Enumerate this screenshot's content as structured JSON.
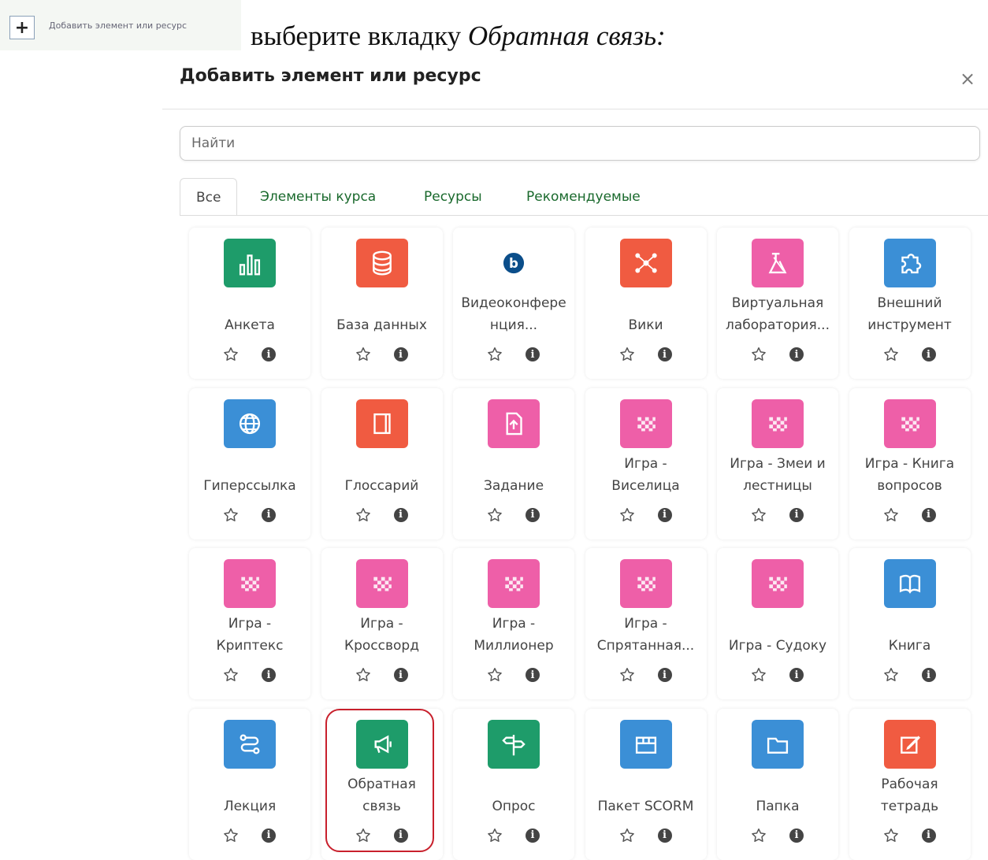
{
  "top": {
    "add_button_symbol": "+",
    "add_link_small": "Добавить элемент или ресурс",
    "instruction_prefix": "выберите вкладку ",
    "instruction_italic": "Обратная связь:"
  },
  "modal": {
    "title": "Добавить элемент или ресурс",
    "close": "×",
    "search_placeholder": "Найти",
    "tabs": [
      {
        "label": "Все",
        "active": true
      },
      {
        "label": "Элементы курса",
        "active": false
      },
      {
        "label": "Ресурсы",
        "active": false
      },
      {
        "label": "Рекомендуемые",
        "active": false
      }
    ],
    "items": [
      {
        "lines": [
          "Анкета"
        ],
        "icon": "bar-chart-icon",
        "color": "#1e9c6a"
      },
      {
        "lines": [
          "База данных"
        ],
        "icon": "database-icon",
        "color": "#f05b41"
      },
      {
        "lines": [
          "Видеоконфере",
          "нция..."
        ],
        "icon": "bigbluebutton-icon",
        "color": "#ffffff"
      },
      {
        "lines": [
          "Вики"
        ],
        "icon": "wiki-network-icon",
        "color": "#f05b41"
      },
      {
        "lines": [
          "Виртуальная",
          "лаборатория..."
        ],
        "icon": "virtual-lab-icon",
        "color": "#ee5fa8"
      },
      {
        "lines": [
          "Внешний",
          "инструмент"
        ],
        "icon": "puzzle-icon",
        "color": "#3b8fd6"
      },
      {
        "lines": [
          "Гиперссылка"
        ],
        "icon": "globe-icon",
        "color": "#3b8fd6"
      },
      {
        "lines": [
          "Глоссарий"
        ],
        "icon": "book-notebook-icon",
        "color": "#f05b41"
      },
      {
        "lines": [
          "Задание"
        ],
        "icon": "file-upload-icon",
        "color": "#ee5fa8"
      },
      {
        "lines": [
          "Игра -",
          "Виселица"
        ],
        "icon": "game-grid-icon",
        "color": "#ee5fa8"
      },
      {
        "lines": [
          "Игра - Змеи и",
          "лестницы"
        ],
        "icon": "game-grid-icon",
        "color": "#ee5fa8"
      },
      {
        "lines": [
          "Игра - Книга",
          "вопросов"
        ],
        "icon": "game-grid-icon",
        "color": "#ee5fa8"
      },
      {
        "lines": [
          "Игра -",
          "Криптекс"
        ],
        "icon": "game-grid-icon",
        "color": "#ee5fa8"
      },
      {
        "lines": [
          "Игра -",
          "Кроссворд"
        ],
        "icon": "game-grid-icon",
        "color": "#ee5fa8"
      },
      {
        "lines": [
          "Игра -",
          "Миллионер"
        ],
        "icon": "game-grid-icon",
        "color": "#ee5fa8"
      },
      {
        "lines": [
          "Игра -",
          "Спрятанная..."
        ],
        "icon": "game-grid-icon",
        "color": "#ee5fa8"
      },
      {
        "lines": [
          "Игра - Судоку"
        ],
        "icon": "game-grid-icon",
        "color": "#ee5fa8"
      },
      {
        "lines": [
          "Книга"
        ],
        "icon": "open-book-icon",
        "color": "#3b8fd6"
      },
      {
        "lines": [
          "Лекция"
        ],
        "icon": "lesson-path-icon",
        "color": "#3b8fd6"
      },
      {
        "lines": [
          "Обратная",
          "связь"
        ],
        "icon": "megaphone-icon",
        "color": "#1e9c6a",
        "highlighted": true
      },
      {
        "lines": [
          "Опрос"
        ],
        "icon": "choice-signpost-icon",
        "color": "#1e9c6a"
      },
      {
        "lines": [
          "Пакет SCORM"
        ],
        "icon": "package-box-icon",
        "color": "#3b8fd6"
      },
      {
        "lines": [
          "Папка"
        ],
        "icon": "folder-icon",
        "color": "#3b8fd6"
      },
      {
        "lines": [
          "Рабочая",
          "тетрадь"
        ],
        "icon": "edit-pencil-icon",
        "color": "#f05b41"
      }
    ],
    "info_glyph": "i"
  }
}
